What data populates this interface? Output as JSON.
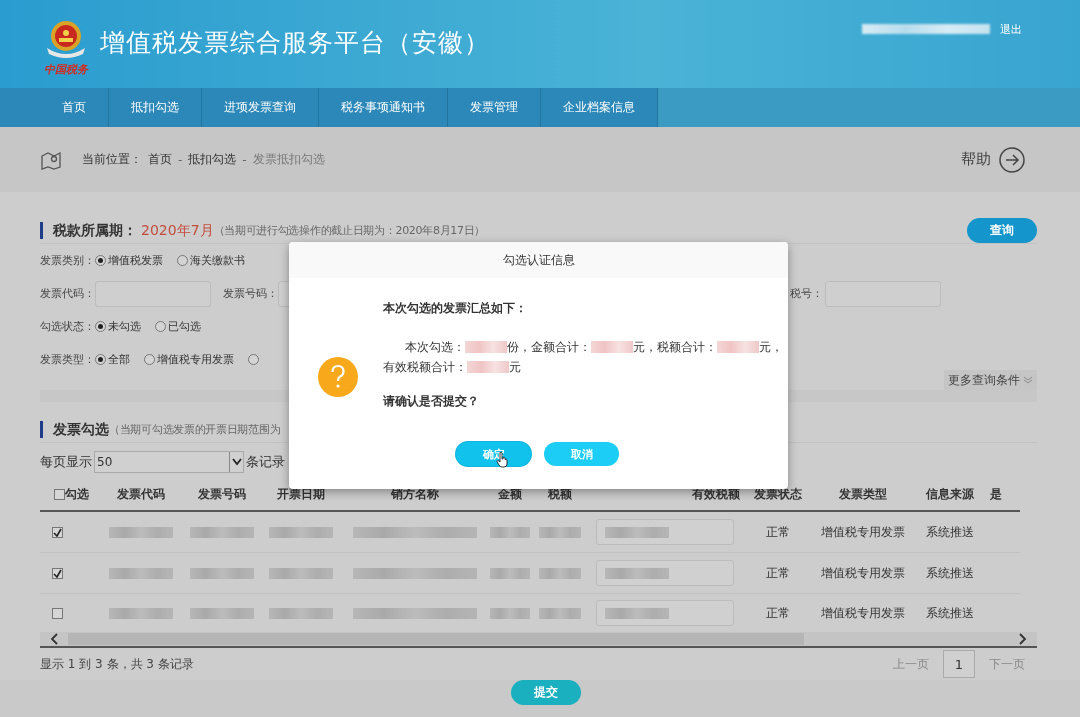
{
  "header": {
    "logo_text": "中国税务",
    "title": "增值税发票综合服务平台（安徽）",
    "logout": "退出"
  },
  "nav": [
    {
      "label": "首页"
    },
    {
      "label": "抵扣勾选"
    },
    {
      "label": "进项发票查询"
    },
    {
      "label": "税务事项通知书"
    },
    {
      "label": "发票管理"
    },
    {
      "label": "企业档案信息"
    }
  ],
  "breadcrumb": {
    "label": "当前位置：",
    "parts": [
      {
        "kind": "link",
        "text": "首页"
      },
      {
        "kind": "sep",
        "text": "-"
      },
      {
        "kind": "link",
        "text": "抵扣勾选"
      },
      {
        "kind": "sep",
        "text": "-"
      },
      {
        "kind": "current",
        "text": "发票抵扣勾选"
      }
    ],
    "help": "帮助"
  },
  "period": {
    "label": "税款所属期：",
    "value": "2020年7月",
    "note": "（当期可进行勾选操作的截止日期为：2020年8月17日）",
    "button": "查询"
  },
  "filters": [
    {
      "kind": "radio",
      "label": "发票类别：",
      "options": [
        {
          "label": "增值税发票",
          "selected": true
        },
        {
          "label": "海关缴款书",
          "selected": false
        }
      ]
    },
    {
      "kind": "fields",
      "fields": [
        {
          "label": "发票代码："
        },
        {
          "label": "发票号码："
        },
        {
          "label": "税号："
        }
      ]
    },
    {
      "kind": "radio",
      "label": "勾选状态：",
      "options": [
        {
          "label": "未勾选",
          "selected": true
        },
        {
          "label": "已勾选",
          "selected": false
        }
      ]
    },
    {
      "kind": "radio",
      "label": "发票类型：",
      "options": [
        {
          "label": "全部",
          "selected": true
        },
        {
          "label": "增值税专用发票",
          "selected": false
        },
        {
          "selected": false
        }
      ]
    }
  ],
  "more_conditions": "更多查询条件",
  "invoice_section": {
    "title": "发票勾选",
    "note": "（当期可勾选发票的开票日期范围为"
  },
  "page_size": {
    "label": "每页显示",
    "value": "50",
    "suffix": "条记录"
  },
  "table": {
    "select_all": {
      "label": "勾选",
      "checked": false
    },
    "columns": [
      {
        "kind": "check"
      },
      {
        "kind": "redacted",
        "label": "发票代码"
      },
      {
        "kind": "redacted",
        "label": "发票号码"
      },
      {
        "kind": "redacted",
        "label": "开票日期"
      },
      {
        "kind": "redacted",
        "label": "销方名称"
      },
      {
        "kind": "redacted",
        "label": "金额"
      },
      {
        "kind": "redacted",
        "label": "税额"
      },
      {
        "kind": "field",
        "label": "有效税额"
      },
      {
        "kind": "text",
        "label": "发票状态"
      },
      {
        "kind": "text",
        "label": "发票类型"
      },
      {
        "kind": "text",
        "label": "信息来源"
      },
      {
        "kind": "blank",
        "label": "是"
      }
    ],
    "rows": [
      {
        "checked": true,
        "cells": [
          "正常",
          "增值税专用发票",
          "系统推送"
        ]
      },
      {
        "checked": true,
        "cells": [
          "正常",
          "增值税专用发票",
          "系统推送"
        ]
      },
      {
        "checked": false,
        "cells": [
          "正常",
          "增值税专用发票",
          "系统推送"
        ]
      }
    ]
  },
  "footer": {
    "summary": "显示 1 到 3 条，共 3 条记录",
    "prev": "上一页",
    "page": "1",
    "next": "下一页",
    "submit": "提交"
  },
  "dialog": {
    "title": "勾选认证信息",
    "heading": "本次勾选的发票汇总如下：",
    "lines": [
      [
        {
          "kind": "text",
          "text": "本次勾选："
        },
        {
          "kind": "redacted"
        },
        {
          "kind": "text",
          "text": "份，金额合计："
        },
        {
          "kind": "redacted"
        },
        {
          "kind": "text",
          "text": "元，税额合计："
        },
        {
          "kind": "redacted"
        },
        {
          "kind": "text",
          "text": "元，"
        }
      ],
      [
        {
          "kind": "text",
          "text": "有效税额合计："
        },
        {
          "kind": "redacted"
        },
        {
          "kind": "text",
          "text": "元"
        }
      ]
    ],
    "question": "请确认是否提交？",
    "buttons": [
      {
        "label": "确定",
        "hover": true
      },
      {
        "label": "取消",
        "hover": false
      }
    ]
  }
}
